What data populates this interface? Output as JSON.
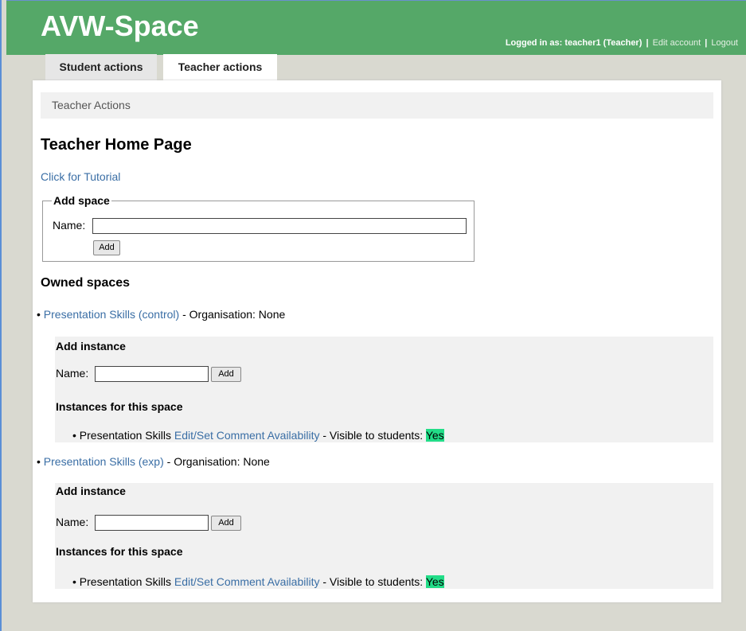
{
  "site": {
    "title": "AVW-Space",
    "logged_in_text": "Logged in as: teacher1 (Teacher)",
    "edit_account": "Edit account",
    "logout": "Logout",
    "separator": "|"
  },
  "tabs": [
    {
      "label": "Student actions",
      "active": false
    },
    {
      "label": "Teacher actions",
      "active": true
    }
  ],
  "breadcrumb": "Teacher Actions",
  "page_title": "Teacher Home Page",
  "tutorial_link": "Click for Tutorial",
  "add_space": {
    "legend": "Add space",
    "name_label": "Name:",
    "name_value": "",
    "button": "Add"
  },
  "owned_spaces_heading": "Owned spaces",
  "spaces": [
    {
      "bullet": "•",
      "name": "Presentation Skills (control)",
      "org_text": " - Organisation: None",
      "add_instance_title": "Add instance",
      "name_label": "Name:",
      "name_value": "",
      "button": "Add",
      "instances_title": "Instances for this space",
      "instances": [
        {
          "bullet": "•",
          "name": "Presentation Skills",
          "link": "Edit/Set Comment Availability",
          "visible_text": " - Visible to students: ",
          "visible_value": "Yes"
        }
      ]
    },
    {
      "bullet": "•",
      "name": "Presentation Skills (exp)",
      "org_text": " - Organisation: None",
      "add_instance_title": "Add instance",
      "name_label": "Name:",
      "name_value": "",
      "button": "Add",
      "instances_title": "Instances for this space",
      "instances": [
        {
          "bullet": "•",
          "name": "Presentation Skills",
          "link": "Edit/Set Comment Availability",
          "visible_text": " - Visible to students: ",
          "visible_value": "Yes"
        }
      ]
    }
  ],
  "colors": {
    "header_green": "#55a868",
    "link_blue": "#3a6ea5",
    "yes_highlight": "#22dd88"
  }
}
